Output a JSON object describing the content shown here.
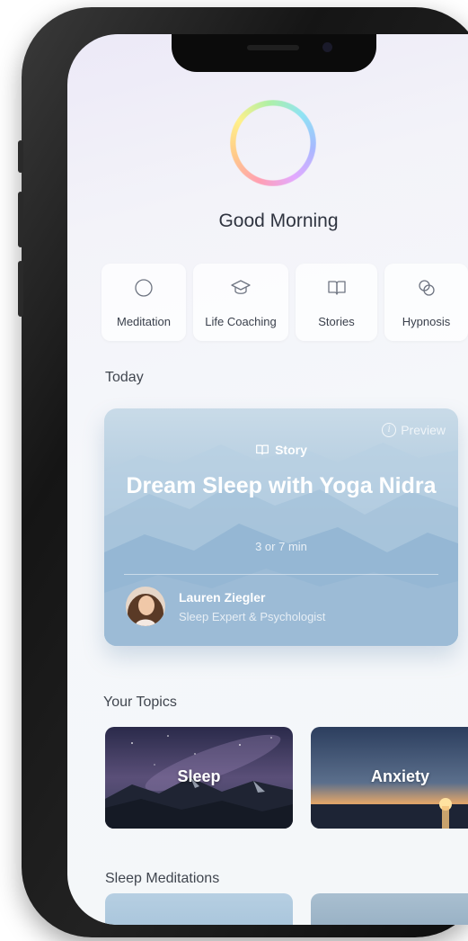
{
  "greeting": "Good Morning",
  "categories": [
    {
      "label": "Meditation",
      "icon": "circle-icon"
    },
    {
      "label": "Life Coaching",
      "icon": "graduation-cap-icon"
    },
    {
      "label": "Stories",
      "icon": "book-icon"
    },
    {
      "label": "Hypnosis",
      "icon": "hypnosis-rings-icon"
    }
  ],
  "today": {
    "section_title": "Today",
    "preview_label": "Preview",
    "tag": "Story",
    "title": "Dream Sleep with Yoga Nidra",
    "duration": "3 or 7 min",
    "author_name": "Lauren Ziegler",
    "author_role": "Sleep Expert & Psychologist"
  },
  "topics": {
    "section_title": "Your Topics",
    "items": [
      {
        "label": "Sleep"
      },
      {
        "label": "Anxiety"
      }
    ]
  },
  "sleep_meditations": {
    "section_title": "Sleep Meditations"
  },
  "colors": {
    "text_primary": "#2f3440",
    "card_blue": "#9dbcd6",
    "screen_bg": "#f4f7f9"
  }
}
